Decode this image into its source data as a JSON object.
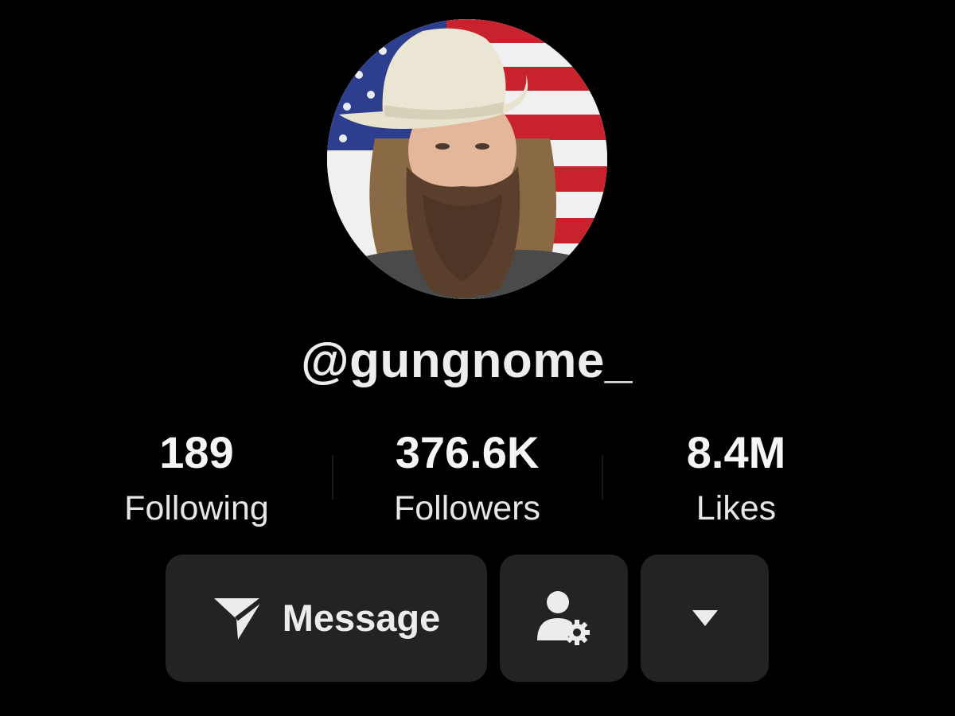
{
  "profile": {
    "username": "@gungnome_",
    "avatar_icon": "profile-photo-cowboy-flag"
  },
  "stats": [
    {
      "value": "189",
      "label": "Following"
    },
    {
      "value": "376.6K",
      "label": "Followers"
    },
    {
      "value": "8.4M",
      "label": "Likes"
    }
  ],
  "actions": {
    "message_label": "Message",
    "message_icon": "send-arrow-icon",
    "follow_settings_icon": "person-gear-icon",
    "more_icon": "triangle-down-icon"
  },
  "colors": {
    "background": "#000000",
    "button_bg": "#232323",
    "text": "#f2f2f2"
  }
}
